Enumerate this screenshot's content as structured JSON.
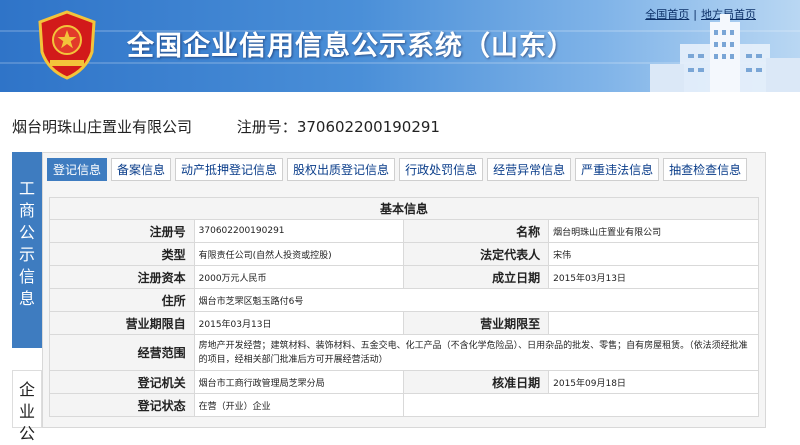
{
  "header": {
    "title": "全国企业信用信息公示系统（山东）",
    "links": [
      "全国首页",
      "地方局首页"
    ],
    "brand_color": "#3a7ccc"
  },
  "company": {
    "name": "烟台明珠山庄置业有限公司",
    "reg_label": "注册号：",
    "reg_no": "370602200190291"
  },
  "side_tabs": [
    {
      "label": "工商公示信息",
      "active": true
    },
    {
      "label": "企业公",
      "active": false
    }
  ],
  "tabs": [
    {
      "label": "登记信息",
      "active": true
    },
    {
      "label": "备案信息",
      "active": false
    },
    {
      "label": "动产抵押登记信息",
      "active": false
    },
    {
      "label": "股权出质登记信息",
      "active": false
    },
    {
      "label": "行政处罚信息",
      "active": false
    },
    {
      "label": "经营异常信息",
      "active": false
    },
    {
      "label": "严重违法信息",
      "active": false
    },
    {
      "label": "抽查检查信息",
      "active": false
    }
  ],
  "basic_info": {
    "section_title": "基本信息",
    "fields": {
      "reg_no": {
        "label": "注册号",
        "value": "370602200190291"
      },
      "name": {
        "label": "名称",
        "value": "烟台明珠山庄置业有限公司"
      },
      "type": {
        "label": "类型",
        "value": "有限责任公司(自然人投资或控股)"
      },
      "legal_rep": {
        "label": "法定代表人",
        "value": "宋伟"
      },
      "capital": {
        "label": "注册资本",
        "value": "2000万元人民币"
      },
      "founded": {
        "label": "成立日期",
        "value": "2015年03月13日"
      },
      "address": {
        "label": "住所",
        "value": "烟台市芝罘区魁玉路付6号"
      },
      "term_from": {
        "label": "营业期限自",
        "value": "2015年03月13日"
      },
      "term_to": {
        "label": "营业期限至",
        "value": ""
      },
      "scope": {
        "label": "经营范围",
        "value": "房地产开发经营；建筑材料、装饰材料、五金交电、化工产品（不含化学危险品）、日用杂品的批发、零售；自有房屋租赁。（依法须经批准的项目，经相关部门批准后方可开展经营活动）"
      },
      "authority": {
        "label": "登记机关",
        "value": "烟台市工商行政管理局芝罘分局"
      },
      "approved": {
        "label": "核准日期",
        "value": "2015年09月18日"
      },
      "status": {
        "label": "登记状态",
        "value": "在营（开业）企业"
      }
    }
  }
}
